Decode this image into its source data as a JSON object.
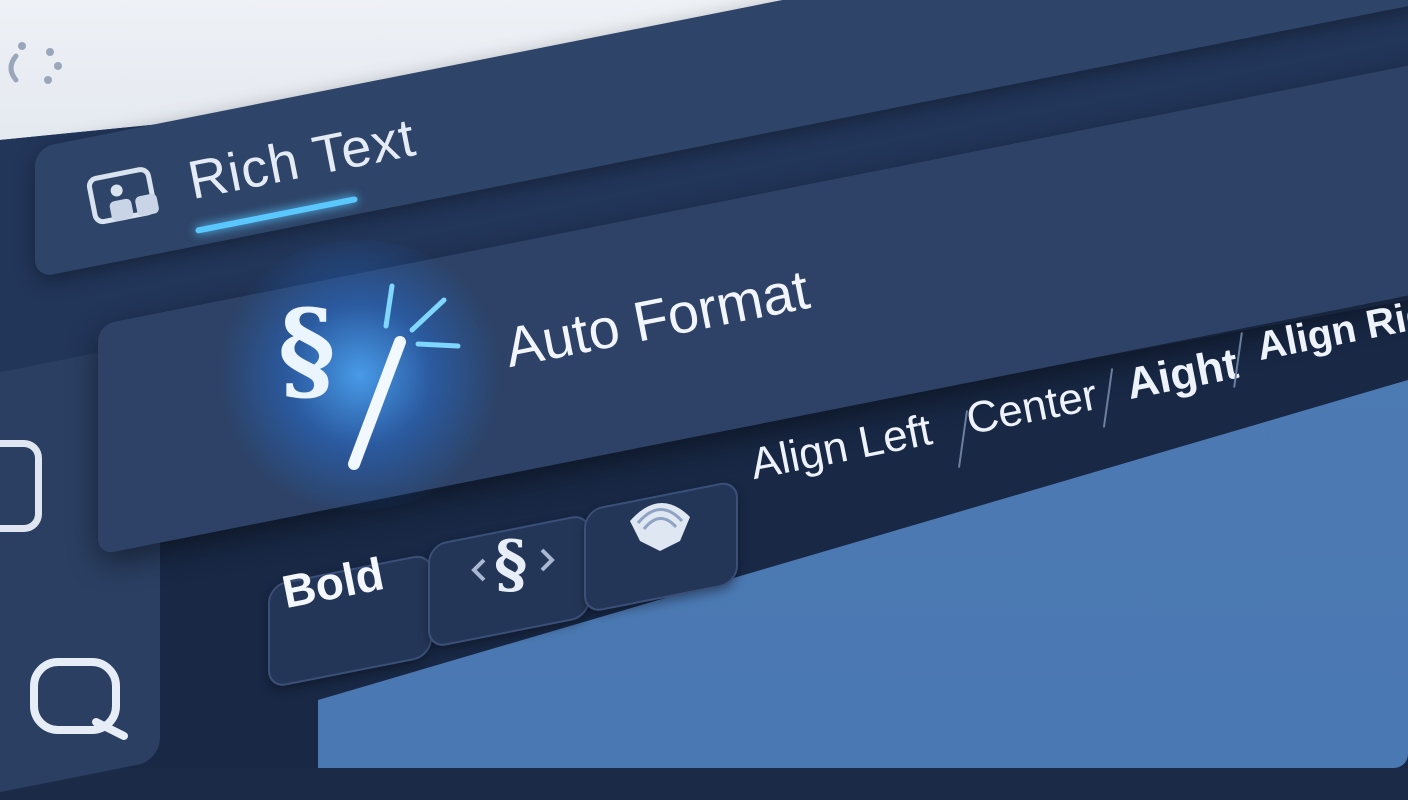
{
  "tab": {
    "label": "Rich Text"
  },
  "auto_format": {
    "label": "Auto Format"
  },
  "toolbar": {
    "bold_label": "Bold",
    "align_left": "Align Left",
    "align_center": "Center",
    "align_aight": "Aight",
    "align_right": "Align Righ"
  },
  "icons": {
    "loader": "loader-icon",
    "rich_text": "rich-text-icon",
    "auto_format": "section-magic-wand-icon",
    "section": "section-sign-icon",
    "wave": "shell-wave-icon"
  },
  "colors": {
    "accent": "#5ac8ff",
    "panel": "#2d4266",
    "editor": "#4a78b2",
    "background": "#1b2b47"
  }
}
